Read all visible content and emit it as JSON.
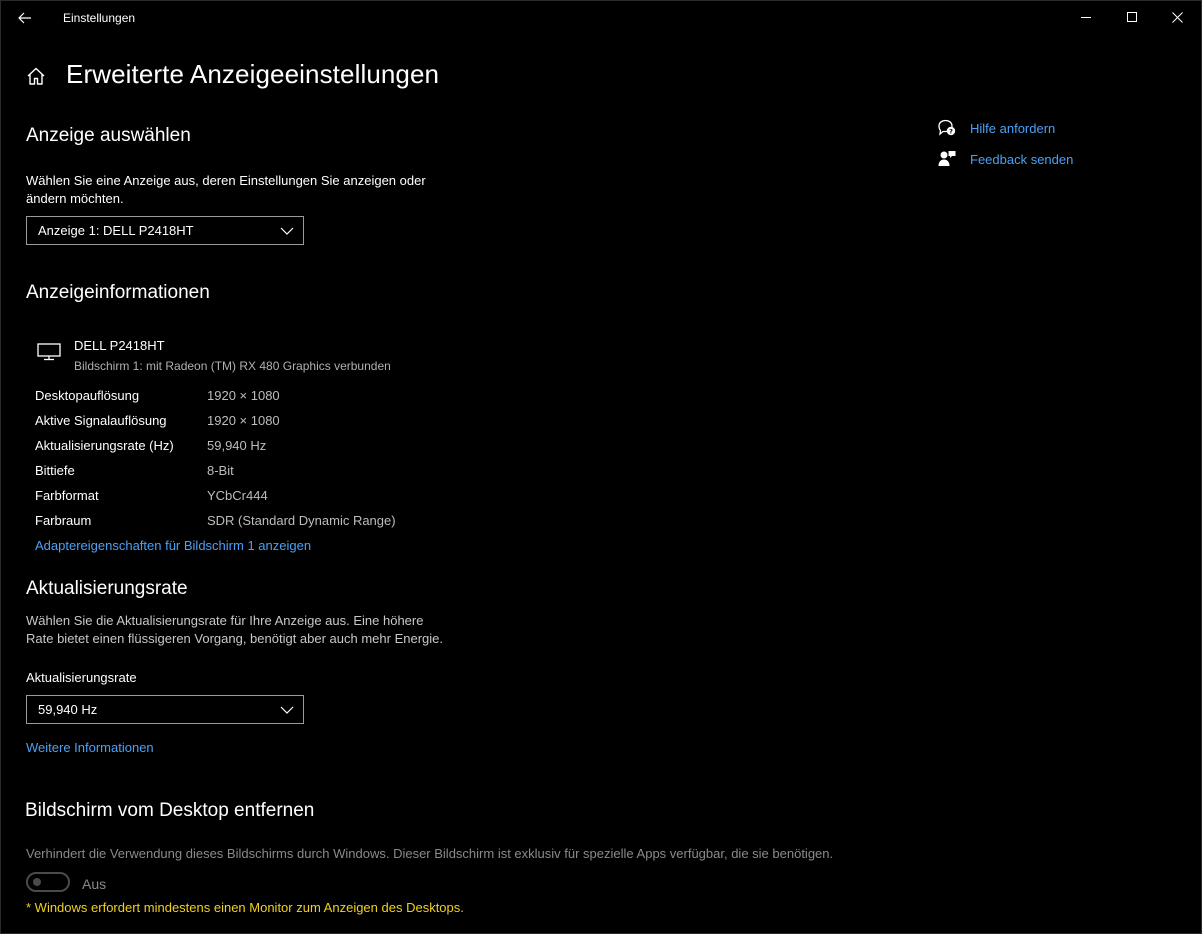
{
  "window": {
    "app_title": "Einstellungen"
  },
  "page": {
    "title": "Erweiterte Anzeigeeinstellungen"
  },
  "select_display": {
    "heading": "Anzeige auswählen",
    "description_line1": "Wählen Sie eine Anzeige aus, deren Einstellungen Sie anzeigen oder",
    "description_line2": "ändern möchten.",
    "dropdown_value": "Anzeige 1: DELL P2418HT"
  },
  "display_info": {
    "heading": "Anzeigeinformationen",
    "monitor_name": "DELL P2418HT",
    "monitor_subtitle": "Bildschirm 1: mit Radeon (TM) RX 480 Graphics verbunden",
    "rows": [
      {
        "label": "Desktopauflösung",
        "value": "1920 × 1080"
      },
      {
        "label": "Aktive Signalauflösung",
        "value": "1920 × 1080"
      },
      {
        "label": "Aktualisierungsrate (Hz)",
        "value": "59,940 Hz"
      },
      {
        "label": "Bittiefe",
        "value": "8-Bit"
      },
      {
        "label": "Farbformat",
        "value": "YCbCr444"
      },
      {
        "label": "Farbraum",
        "value": "SDR (Standard Dynamic Range)"
      }
    ],
    "adapter_link": "Adaptereigenschaften für Bildschirm 1 anzeigen"
  },
  "refresh_rate": {
    "heading": "Aktualisierungsrate",
    "description_line1": "Wählen Sie die Aktualisierungsrate für Ihre Anzeige aus. Eine höhere",
    "description_line2": "Rate bietet einen flüssigeren Vorgang, benötigt aber auch mehr Energie.",
    "field_label": "Aktualisierungsrate",
    "dropdown_value": "59,940 Hz",
    "more_info_link": "Weitere Informationen"
  },
  "remove_display": {
    "heading": "Bildschirm vom Desktop entfernen",
    "description": "Verhindert die Verwendung dieses Bildschirms durch Windows. Dieser Bildschirm ist exklusiv für spezielle Apps verfügbar, die sie benötigen.",
    "toggle_state": "Aus",
    "warning": "* Windows erfordert mindestens einen Monitor zum Anzeigen des Desktops."
  },
  "sidebar": {
    "help_label": "Hilfe anfordern",
    "help_icon": "help-chat-icon",
    "feedback_label": "Feedback senden",
    "feedback_icon": "feedback-icon"
  },
  "colors": {
    "background": "#000000",
    "link": "#4ca0f5",
    "warning": "#f0d020"
  }
}
